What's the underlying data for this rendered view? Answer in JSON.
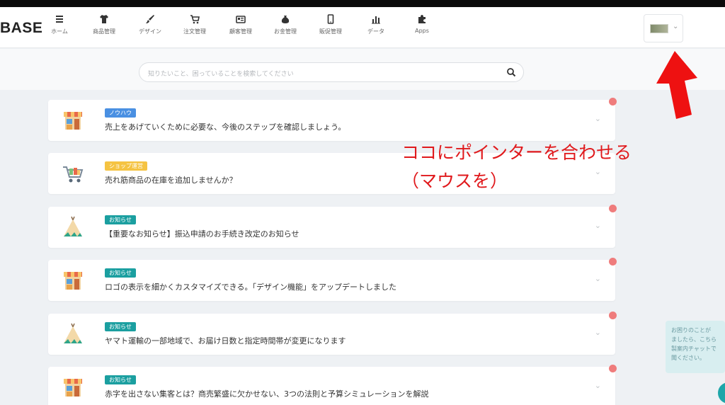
{
  "logo": "BASE",
  "nav": [
    {
      "label": "ホーム",
      "icon": "menu-icon"
    },
    {
      "label": "商品管理",
      "icon": "tshirt-icon"
    },
    {
      "label": "デザイン",
      "icon": "brush-icon"
    },
    {
      "label": "注文管理",
      "icon": "cart-icon"
    },
    {
      "label": "顧客管理",
      "icon": "id-card-icon"
    },
    {
      "label": "お金管理",
      "icon": "money-bag-icon"
    },
    {
      "label": "販促管理",
      "icon": "smartphone-icon"
    },
    {
      "label": "データ",
      "icon": "bar-chart-icon"
    },
    {
      "label": "Apps",
      "icon": "puzzle-icon"
    }
  ],
  "search": {
    "placeholder": "知りたいこと、困っていることを検索してください"
  },
  "cards": [
    {
      "badge": "ノウハウ",
      "badge_color": "#4a90e2",
      "text": "売上をあげていくために必要な、今後のステップを確認しましょう。",
      "icon": "shop-icon",
      "unread": true
    },
    {
      "badge": "ショップ運営",
      "badge_color": "#f5c342",
      "text": "売れ筋商品の在庫を追加しませんか？",
      "icon": "shopping-cart-icon",
      "unread": false
    },
    {
      "badge": "お知らせ",
      "badge_color": "#1b9fa0",
      "text": "【重要なお知らせ】振込申請のお手続き改定のお知らせ",
      "icon": "tent-icon",
      "unread": true
    },
    {
      "badge": "お知らせ",
      "badge_color": "#1b9fa0",
      "text": "ロゴの表示を細かくカスタマイズできる。「デザイン機能」をアップデートしました",
      "icon": "shop-icon",
      "unread": true
    },
    {
      "badge": "お知らせ",
      "badge_color": "#1b9fa0",
      "text": "ヤマト運輸の一部地域で、お届け日数と指定時間帯が変更になります",
      "icon": "tent-icon",
      "unread": true
    },
    {
      "badge": "お知らせ",
      "badge_color": "#1b9fa0",
      "text": "赤字を出さない集客とは？商売繁盛に欠かせない、3つの法則と予算シミュレーションを解説",
      "icon": "shop-icon",
      "unread": true
    }
  ],
  "annotation": {
    "line1": "ココにポインターを合わせる",
    "line2": "（マウスを）",
    "color": "#e0191c"
  },
  "chat": {
    "lines": [
      "お困りのことが",
      "ましたら、こちら",
      "製案内チャットで",
      "聞ください。"
    ]
  }
}
